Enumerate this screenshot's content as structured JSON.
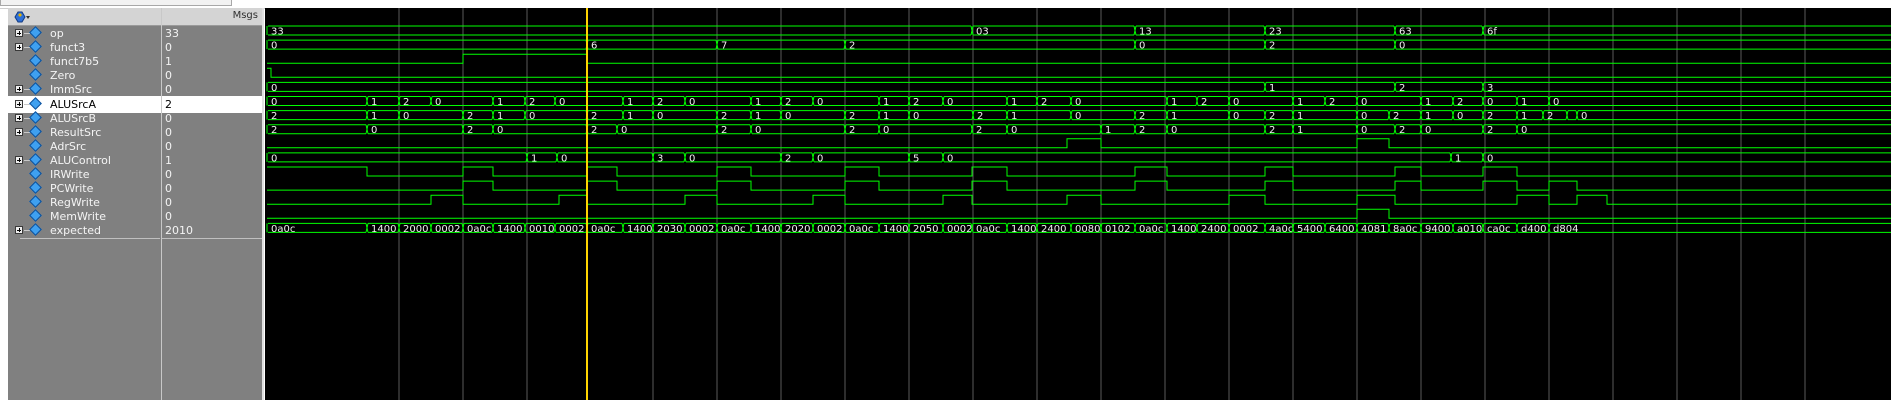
{
  "window": {
    "values_header": "Msgs",
    "toolbar_icon": "wave-format-gear-icon"
  },
  "colors": {
    "wave": "#00ff00",
    "cursor": "#ffd400",
    "grid": "#5a5a5a",
    "pane_bg": "#808080",
    "wave_bg": "#000000"
  },
  "signals": [
    {
      "name": "op",
      "value": "33",
      "bus": true,
      "expandable": true
    },
    {
      "name": "funct3",
      "value": "0",
      "bus": true,
      "expandable": true
    },
    {
      "name": "funct7b5",
      "value": "1",
      "bus": false,
      "expandable": false
    },
    {
      "name": "Zero",
      "value": "0",
      "bus": false,
      "expandable": false
    },
    {
      "name": "ImmSrc",
      "value": "0",
      "bus": true,
      "expandable": true
    },
    {
      "name": "ALUSrcA",
      "value": "2",
      "bus": true,
      "expandable": true,
      "selected": true
    },
    {
      "name": "ALUSrcB",
      "value": "0",
      "bus": true,
      "expandable": true
    },
    {
      "name": "ResultSrc",
      "value": "0",
      "bus": true,
      "expandable": true
    },
    {
      "name": "AdrSrc",
      "value": "0",
      "bus": false,
      "expandable": false
    },
    {
      "name": "ALUControl",
      "value": "1",
      "bus": true,
      "expandable": true
    },
    {
      "name": "IRWrite",
      "value": "0",
      "bus": false,
      "expandable": false
    },
    {
      "name": "PCWrite",
      "value": "0",
      "bus": false,
      "expandable": false
    },
    {
      "name": "RegWrite",
      "value": "0",
      "bus": false,
      "expandable": false
    },
    {
      "name": "MemWrite",
      "value": "0",
      "bus": false,
      "expandable": false
    },
    {
      "name": "expected",
      "value": "2010",
      "bus": true,
      "expandable": true
    }
  ],
  "waveforms": {
    "end": 1630,
    "cursor_time": 320,
    "gridlines": [
      132,
      196,
      260,
      320,
      386,
      450,
      514,
      578,
      642,
      706,
      770,
      834,
      898,
      962,
      1026,
      1090,
      1154,
      1218,
      1282,
      1346,
      1410,
      1474,
      1538
    ],
    "rows": [
      {
        "kind": "bus",
        "segs": [
          [
            0,
            "33"
          ],
          [
            705,
            "03"
          ],
          [
            868,
            "13"
          ],
          [
            998,
            "23"
          ],
          [
            1128,
            "63"
          ],
          [
            1216,
            "6f"
          ]
        ]
      },
      {
        "kind": "bus",
        "segs": [
          [
            0,
            "0"
          ],
          [
            320,
            "6"
          ],
          [
            450,
            "7"
          ],
          [
            578,
            "2"
          ],
          [
            868,
            "0"
          ],
          [
            998,
            "2"
          ],
          [
            1128,
            "0"
          ]
        ]
      },
      {
        "kind": "bit",
        "init": 0,
        "edges": [
          196,
          320
        ]
      },
      {
        "kind": "bit",
        "init": 1,
        "edges": [
          4
        ]
      },
      {
        "kind": "bus",
        "segs": [
          [
            0,
            "0"
          ],
          [
            998,
            "1"
          ],
          [
            1128,
            "2"
          ],
          [
            1216,
            "3"
          ]
        ]
      },
      {
        "kind": "bus",
        "segs": [
          [
            0,
            "0"
          ],
          [
            100,
            "1"
          ],
          [
            132,
            "2"
          ],
          [
            164,
            "0"
          ],
          [
            226,
            "1"
          ],
          [
            258,
            "2"
          ],
          [
            288,
            "0"
          ],
          [
            356,
            "1"
          ],
          [
            386,
            "2"
          ],
          [
            418,
            "0"
          ],
          [
            484,
            "1"
          ],
          [
            514,
            "2"
          ],
          [
            546,
            "0"
          ],
          [
            612,
            "1"
          ],
          [
            642,
            "2"
          ],
          [
            676,
            "0"
          ],
          [
            740,
            "1"
          ],
          [
            770,
            "2"
          ],
          [
            804,
            "0"
          ],
          [
            900,
            "1"
          ],
          [
            930,
            "2"
          ],
          [
            962,
            "0"
          ],
          [
            1026,
            "1"
          ],
          [
            1058,
            "2"
          ],
          [
            1090,
            "0"
          ],
          [
            1154,
            "1"
          ],
          [
            1186,
            "2"
          ],
          [
            1216,
            "0"
          ],
          [
            1250,
            "1"
          ],
          [
            1282,
            "0"
          ]
        ]
      },
      {
        "kind": "bus",
        "segs": [
          [
            0,
            "2"
          ],
          [
            100,
            "1"
          ],
          [
            132,
            "0"
          ],
          [
            196,
            "2"
          ],
          [
            226,
            "1"
          ],
          [
            258,
            "0"
          ],
          [
            320,
            "2"
          ],
          [
            356,
            "1"
          ],
          [
            386,
            "0"
          ],
          [
            450,
            "2"
          ],
          [
            484,
            "1"
          ],
          [
            514,
            "0"
          ],
          [
            578,
            "2"
          ],
          [
            612,
            "1"
          ],
          [
            642,
            "0"
          ],
          [
            706,
            "2"
          ],
          [
            740,
            "1"
          ],
          [
            804,
            "0"
          ],
          [
            868,
            "2"
          ],
          [
            900,
            "1"
          ],
          [
            962,
            "0"
          ],
          [
            998,
            "2"
          ],
          [
            1026,
            "1"
          ],
          [
            1090,
            "0"
          ],
          [
            1122,
            "2"
          ],
          [
            1154,
            "1"
          ],
          [
            1186,
            "0"
          ],
          [
            1216,
            "2"
          ],
          [
            1250,
            "1"
          ],
          [
            1276,
            "2"
          ],
          [
            1300,
            "1"
          ],
          [
            1310,
            "0"
          ]
        ]
      },
      {
        "kind": "bus",
        "segs": [
          [
            0,
            "2"
          ],
          [
            100,
            "0"
          ],
          [
            196,
            "2"
          ],
          [
            226,
            "0"
          ],
          [
            320,
            "2"
          ],
          [
            350,
            "0"
          ],
          [
            450,
            "2"
          ],
          [
            484,
            "0"
          ],
          [
            578,
            "2"
          ],
          [
            612,
            "0"
          ],
          [
            705,
            "2"
          ],
          [
            740,
            "0"
          ],
          [
            834,
            "1"
          ],
          [
            868,
            "2"
          ],
          [
            900,
            "0"
          ],
          [
            998,
            "2"
          ],
          [
            1026,
            "1"
          ],
          [
            1090,
            "0"
          ],
          [
            1128,
            "2"
          ],
          [
            1154,
            "0"
          ],
          [
            1216,
            "2"
          ],
          [
            1250,
            "0"
          ]
        ]
      },
      {
        "kind": "bit",
        "init": 0,
        "edges": [
          800,
          834,
          1090,
          1122
        ]
      },
      {
        "kind": "bus",
        "segs": [
          [
            0,
            "0"
          ],
          [
            260,
            "1"
          ],
          [
            290,
            "0"
          ],
          [
            386,
            "3"
          ],
          [
            418,
            "0"
          ],
          [
            514,
            "2"
          ],
          [
            546,
            "0"
          ],
          [
            642,
            "5"
          ],
          [
            676,
            "0"
          ],
          [
            1184,
            "1"
          ],
          [
            1216,
            "0"
          ]
        ]
      },
      {
        "kind": "bit",
        "init": 1,
        "edges": [
          100,
          196,
          226,
          320,
          350,
          450,
          484,
          578,
          612,
          705,
          740,
          868,
          900,
          998,
          1026,
          1128,
          1154,
          1216,
          1250
        ]
      },
      {
        "kind": "bit",
        "init": 0,
        "edges": [
          196,
          226,
          320,
          350,
          450,
          484,
          578,
          612,
          705,
          740,
          868,
          900,
          998,
          1026,
          1128,
          1154,
          1216,
          1250,
          1282,
          1310
        ]
      },
      {
        "kind": "bit",
        "init": 0,
        "edges": [
          164,
          196,
          292,
          320,
          418,
          450,
          546,
          578,
          676,
          705,
          800,
          834,
          962,
          998,
          1090,
          1128,
          1250,
          1282,
          1310,
          1340
        ]
      },
      {
        "kind": "bit",
        "init": 0,
        "edges": [
          1090,
          1122
        ]
      },
      {
        "kind": "bus",
        "segs": [
          [
            0,
            "0a0c"
          ],
          [
            100,
            "1400"
          ],
          [
            132,
            "2000"
          ],
          [
            164,
            "0002"
          ],
          [
            196,
            "0a0c"
          ],
          [
            226,
            "1400"
          ],
          [
            258,
            "0010"
          ],
          [
            288,
            "0002"
          ],
          [
            320,
            "0a0c"
          ],
          [
            356,
            "1400"
          ],
          [
            386,
            "2030"
          ],
          [
            418,
            "0002"
          ],
          [
            450,
            "0a0c"
          ],
          [
            484,
            "1400"
          ],
          [
            514,
            "2020"
          ],
          [
            546,
            "0002"
          ],
          [
            578,
            "0a0c"
          ],
          [
            612,
            "1400"
          ],
          [
            642,
            "2050"
          ],
          [
            676,
            "0002"
          ],
          [
            705,
            "0a0c"
          ],
          [
            740,
            "1400"
          ],
          [
            770,
            "2400"
          ],
          [
            804,
            "0080"
          ],
          [
            834,
            "0102"
          ],
          [
            868,
            "0a0c"
          ],
          [
            900,
            "1400"
          ],
          [
            930,
            "2400"
          ],
          [
            962,
            "0002"
          ],
          [
            998,
            "4a0c"
          ],
          [
            1026,
            "5400"
          ],
          [
            1058,
            "6400"
          ],
          [
            1090,
            "4081"
          ],
          [
            1122,
            "8a0c"
          ],
          [
            1154,
            "9400"
          ],
          [
            1186,
            "a010"
          ],
          [
            1216,
            "ca0c"
          ],
          [
            1250,
            "d400"
          ],
          [
            1282,
            "d804"
          ]
        ]
      }
    ]
  }
}
